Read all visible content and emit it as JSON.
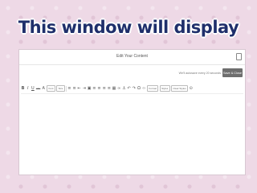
{
  "slide": {
    "title": "This window will display"
  },
  "editor": {
    "title": "Edit Your Content",
    "autosave_text": "We'll autosave every 20 seconds",
    "save_close_label": "Save & Close"
  },
  "toolbar": {
    "bold": "B",
    "italic": "I",
    "underline": "U",
    "strike": "abc",
    "font_family": "Font",
    "font_size": "Size",
    "format": "Format",
    "styles": "Styles",
    "clear_styles": "Clear Styles",
    "colors": {
      "border": "#bbbbbb",
      "icon": "#555555"
    }
  },
  "colors": {
    "title": "#1f2f6b",
    "background": "#eed9e6",
    "button": "#6e6e6e"
  }
}
